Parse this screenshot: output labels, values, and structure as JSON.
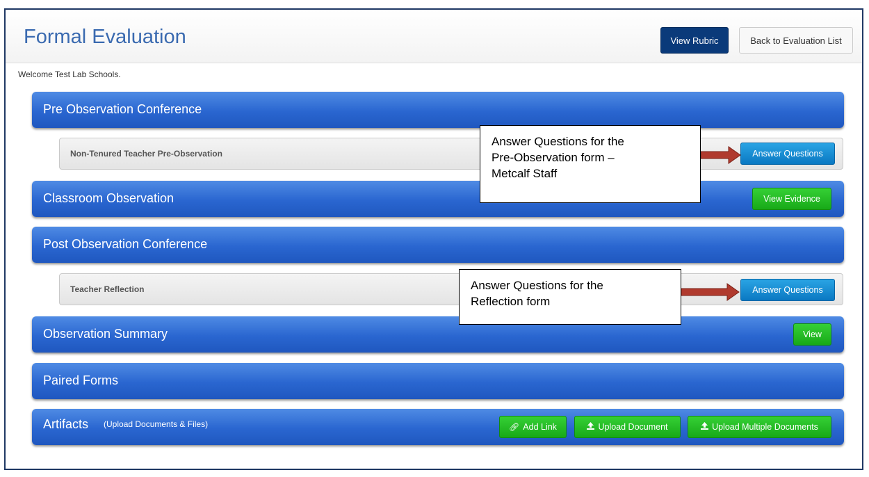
{
  "header": {
    "title": "Formal Evaluation",
    "view_rubric": "View Rubric",
    "back_to_list": "Back to Evaluation List"
  },
  "welcome": "Welcome Test Lab Schools.",
  "sections": {
    "pre_observation": {
      "title": "Pre Observation Conference",
      "item_label": "Non-Tenured Teacher Pre-Observation",
      "button": "Answer Questions"
    },
    "classroom_observation": {
      "title": "Classroom Observation",
      "button": "View Evidence"
    },
    "post_observation": {
      "title": "Post Observation Conference",
      "item_label": "Teacher Reflection",
      "button": "Answer Questions"
    },
    "observation_summary": {
      "title": "Observation Summary",
      "button": "View"
    },
    "paired_forms": {
      "title": "Paired Forms"
    },
    "artifacts": {
      "title": "Artifacts",
      "subtitle": "(Upload Documents & Files)",
      "add_link": "Add Link",
      "upload_document": "Upload Document",
      "upload_multiple": "Upload Multiple Documents"
    }
  },
  "annotations": {
    "callout_1_line1": "Answer Questions for the",
    "callout_1_line2": "Pre-Observation form –",
    "callout_1_line3": "Metcalf Staff",
    "callout_2_line1": "Answer Questions for the",
    "callout_2_line2": "Reflection form"
  },
  "colors": {
    "title_blue": "#3a6ab0",
    "bar_blue": "#2a66d0",
    "rubric_navy": "#0a3a7a",
    "button_blue": "#0a78c2",
    "button_green": "#18a918",
    "arrow_red": "#b03a2e"
  },
  "icons": {
    "add_link": "link-icon",
    "upload": "upload-icon"
  }
}
